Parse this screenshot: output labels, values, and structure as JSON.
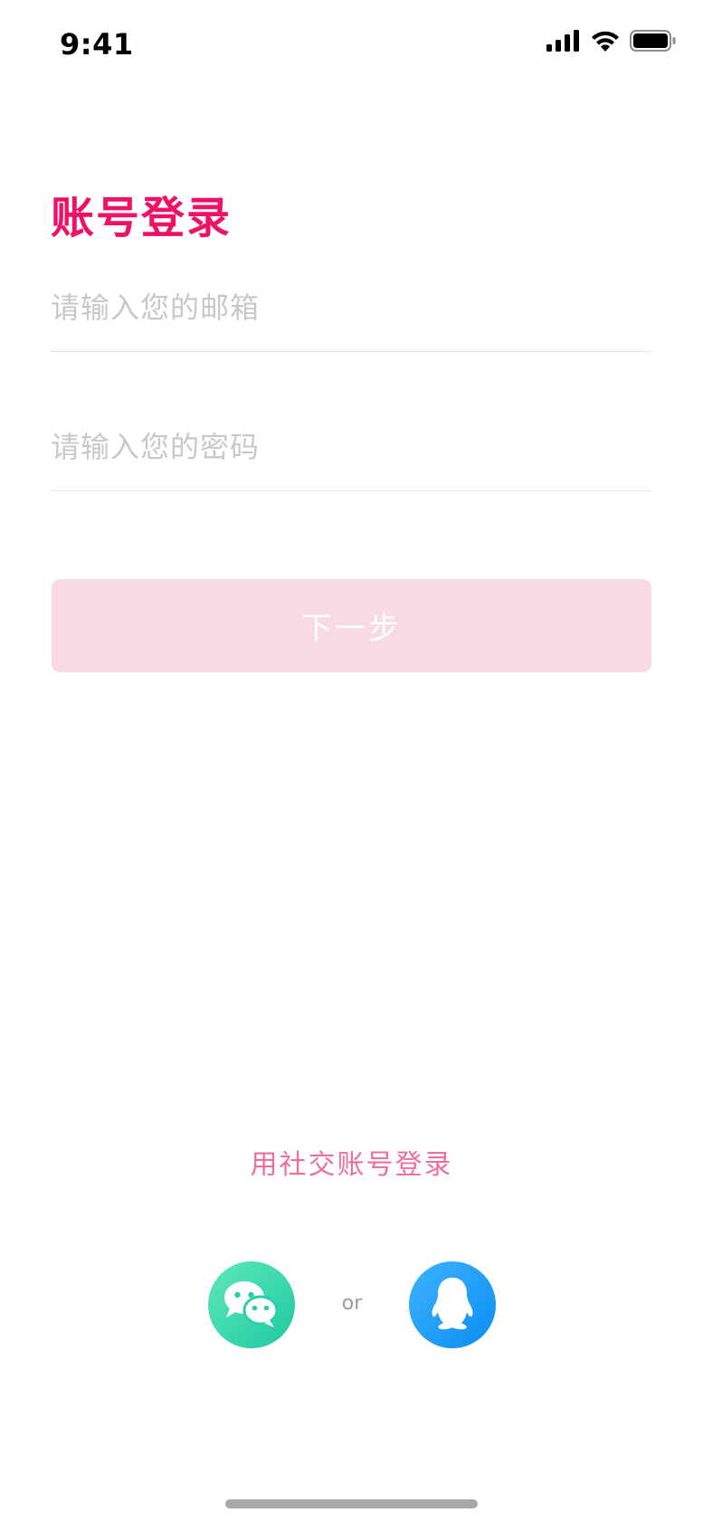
{
  "status_bar": {
    "time": "9:41",
    "icons": [
      "signal-icon",
      "wifi-icon",
      "battery-icon"
    ]
  },
  "login": {
    "title": "账号登录",
    "email_placeholder": "请输入您的邮箱",
    "email_value": "",
    "password_placeholder": "请输入您的密码",
    "password_value": "",
    "next_label": "下一步"
  },
  "social": {
    "label": "用社交账号登录",
    "or_label": "or",
    "providers": [
      "wechat-icon",
      "qq-icon"
    ]
  },
  "colors": {
    "accent": "#ee1166",
    "button_disabled": "#f9d9e3",
    "social_text": "#ee6f9c",
    "wechat": "#2bd6a8",
    "qq": "#1a9af5"
  }
}
